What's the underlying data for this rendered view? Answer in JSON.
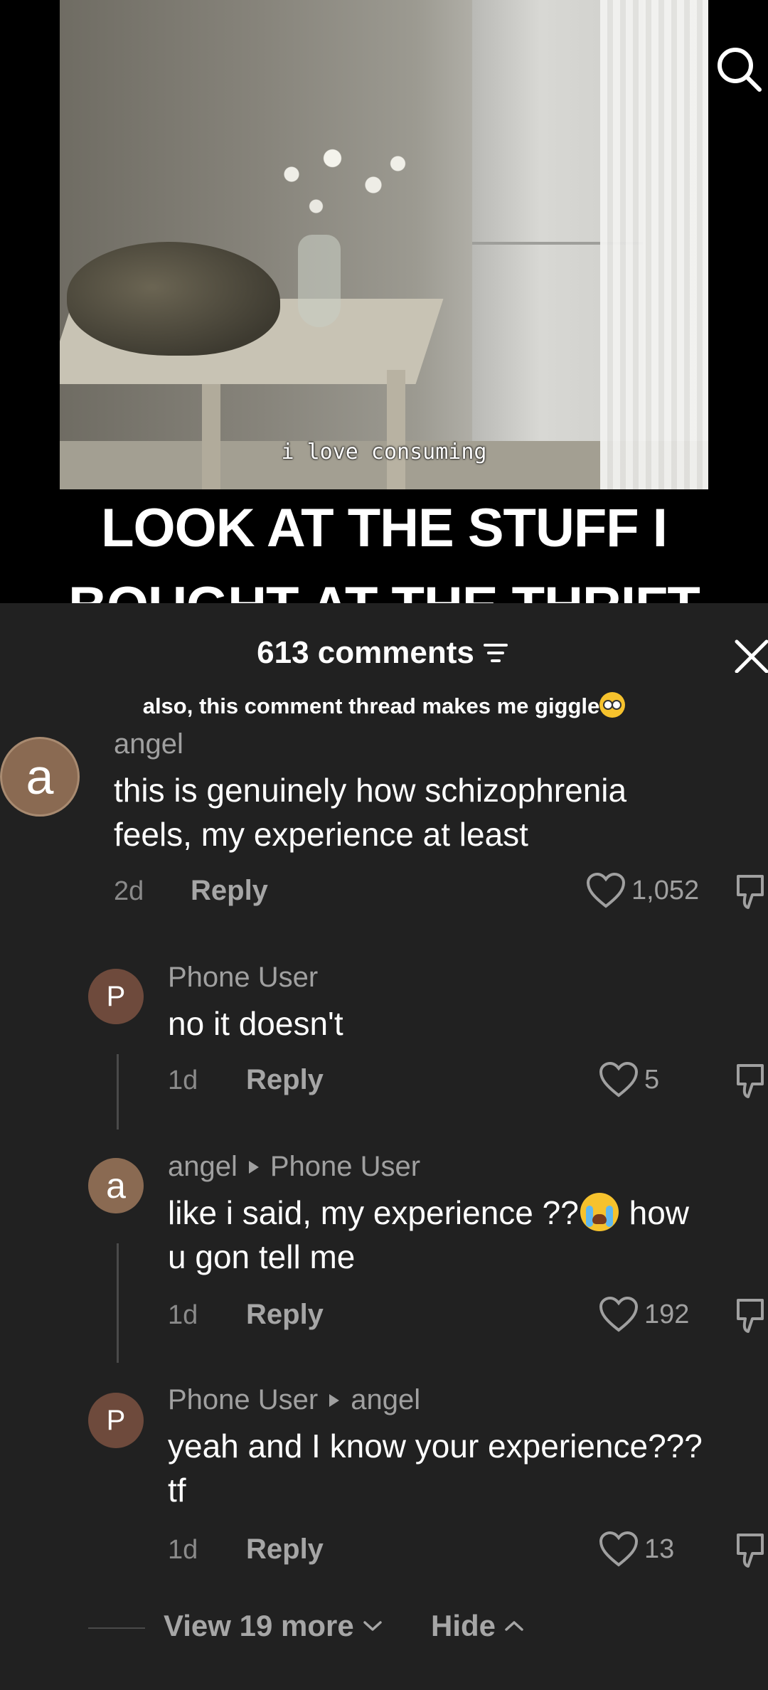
{
  "video": {
    "caption": "i love consuming",
    "headline_line1": "LOOK AT THE STUFF I",
    "headline_line2": "BOUGHT AT THE THRIFT",
    "search_icon": "search-icon"
  },
  "comments_header": {
    "count_label": "613 comments",
    "filter_icon": "filter-icon",
    "close_icon": "close-icon"
  },
  "note": {
    "text": "also, this comment thread makes me giggle",
    "emoji": "pleading-face"
  },
  "comments": [
    {
      "avatar_letter": "a",
      "username": "angel",
      "text_line1": "this is genuinely how schizophrenia",
      "text_line2": "feels, my experience at least",
      "time": "2d",
      "reply_label": "Reply",
      "likes": "1,052"
    },
    {
      "avatar_letter": "P",
      "username": "Phone User",
      "text_line1": "no it doesn't",
      "time": "1d",
      "reply_label": "Reply",
      "likes": "5"
    },
    {
      "avatar_letter": "a",
      "username": "angel",
      "reply_to": "Phone User",
      "text_line1a": "like i said, my experience ??",
      "text_line1b": " how",
      "text_line2": "u gon tell me",
      "emoji": "crying-face",
      "time": "1d",
      "reply_label": "Reply",
      "likes": "192"
    },
    {
      "avatar_letter": "P",
      "username": "Phone User",
      "reply_to": "angel",
      "text_line1": "yeah and I know your experience???",
      "text_line2": "tf",
      "time": "1d",
      "reply_label": "Reply",
      "likes": "13"
    }
  ],
  "footer": {
    "view_more": "View 19 more",
    "hide": "Hide"
  },
  "colors": {
    "sheet_bg": "#212121",
    "muted_text": "#a0a0a0",
    "avatar_a": "#8a6a52",
    "avatar_p": "#6e4a3c"
  }
}
